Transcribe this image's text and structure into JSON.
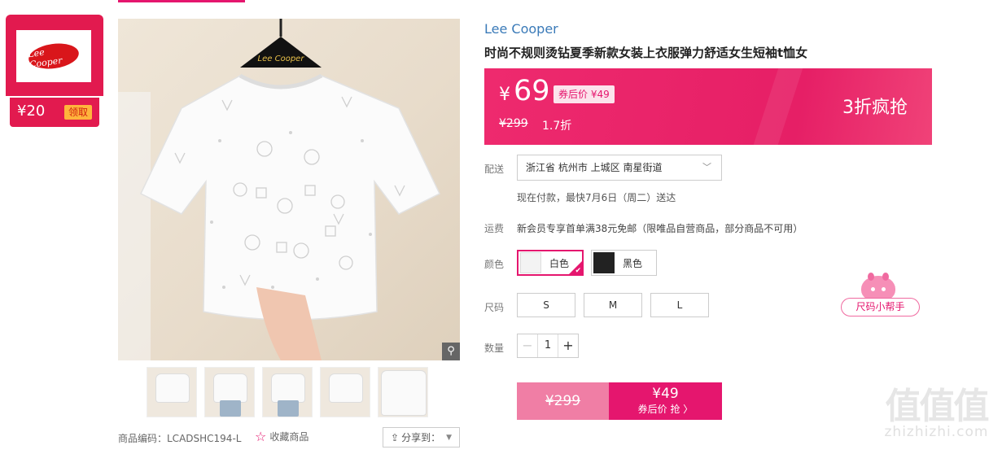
{
  "coupon": {
    "value": "¥20",
    "claim_label": "领取",
    "logo_text": "Lee Cooper"
  },
  "gallery": {
    "zoom_icon": "magnifier-icon",
    "thumb_count": 5,
    "hanger_text": "Lee Cooper"
  },
  "product": {
    "brand": "Lee Cooper",
    "title": "时尚不规则烫钻夏季新款女装上衣服弹力舒适女生短袖t恤女",
    "sku_code": "商品编码：LCADSHC194-L",
    "favorite_label": "收藏商品",
    "share_label": "分享到："
  },
  "price": {
    "currency": "¥",
    "current": "69",
    "coupon_tag": "券后价 ¥49",
    "original": "¥299",
    "discount": "1.7折",
    "promo": "3折疯抢"
  },
  "delivery": {
    "label": "配送",
    "address": "浙江省 杭州市 上城区 南星街道",
    "note": "现在付款，最快7月6日（周二）送达"
  },
  "freight": {
    "label": "运费",
    "text": "新会员专享首单满38元免邮（限唯品自营商品，部分商品不可用）"
  },
  "colors": {
    "label": "颜色",
    "options": [
      {
        "name": "白色",
        "selected": true
      },
      {
        "name": "黑色",
        "selected": false
      }
    ]
  },
  "sizes": {
    "label": "尺码",
    "options": [
      "S",
      "M",
      "L"
    ],
    "helper": "尺码小帮手"
  },
  "quantity": {
    "label": "数量",
    "value": "1",
    "minus": "−",
    "plus": "+"
  },
  "buy": {
    "original": "¥299",
    "price": "¥49",
    "action": "券后价 抢 〉"
  },
  "watermark": {
    "big": "值值值",
    "small": "zhizhizhi.com"
  },
  "colors_theme": {
    "accent": "#e5166e",
    "brand_link": "#3a7ab8",
    "coupon_red": "#e21a4f"
  }
}
